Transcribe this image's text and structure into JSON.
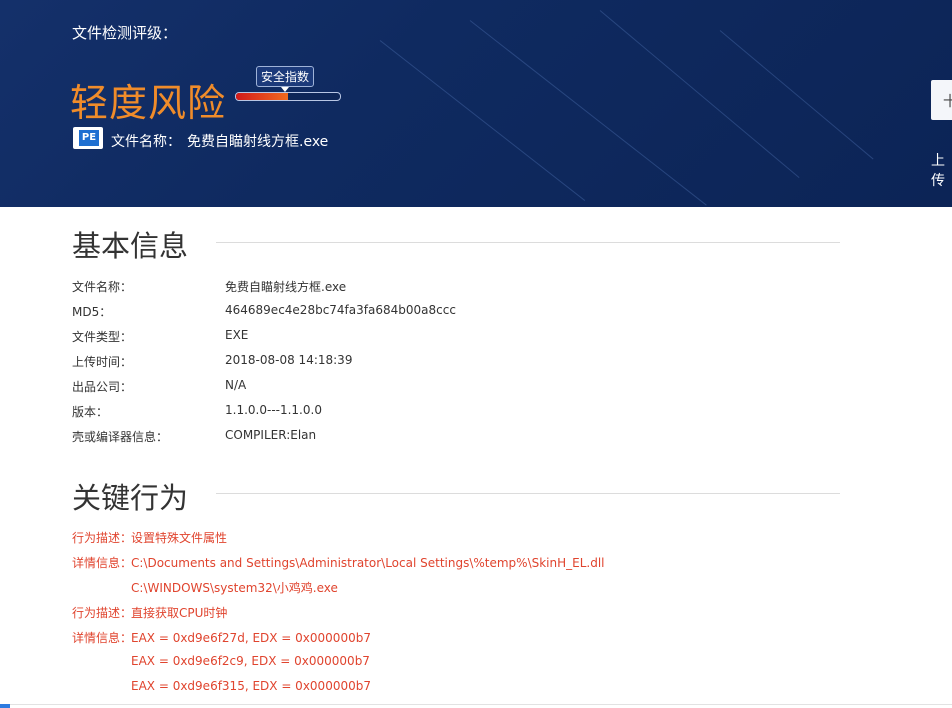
{
  "header": {
    "rating_label": "文件检测评级：",
    "risk_level": "轻度风险",
    "index_tag": "安全指数",
    "safety_index_fraction": 0.5,
    "file_name_label": "文件名称：",
    "file_name": "免费自瞄射线方框.exe",
    "file_icon_text": "PE",
    "right_button_glyph": "十",
    "right_text": "上传"
  },
  "basic_info": {
    "title": "基本信息",
    "rows": [
      {
        "key": "文件名称：",
        "value": "免费自瞄射线方框.exe"
      },
      {
        "key": "MD5：",
        "value": "464689ec4e28bc74fa3fa684b00a8ccc"
      },
      {
        "key": "文件类型：",
        "value": "EXE"
      },
      {
        "key": "上传时间：",
        "value": "2018-08-08 14:18:39"
      },
      {
        "key": "出品公司：",
        "value": "N/A"
      },
      {
        "key": "版本：",
        "value": "1.1.0.0---1.1.0.0"
      },
      {
        "key": "壳或编译器信息：",
        "value": "COMPILER:Elan"
      }
    ]
  },
  "key_behaviors": {
    "title": "关键行为",
    "lines": [
      {
        "key": "行为描述：",
        "value": "设置特殊文件属性"
      },
      {
        "key": "详情信息：",
        "value": "C:\\Documents and Settings\\Administrator\\Local Settings\\%temp%\\SkinH_EL.dll"
      },
      {
        "key": "",
        "value": "C:\\WINDOWS\\system32\\小鸡鸡.exe"
      },
      {
        "key": "行为描述：",
        "value": "直接获取CPU时钟"
      },
      {
        "key": "详情信息：",
        "value": "EAX = 0xd9e6f27d, EDX = 0x000000b7"
      },
      {
        "key": "",
        "value": "EAX = 0xd9e6f2c9, EDX = 0x000000b7"
      },
      {
        "key": "",
        "value": "EAX = 0xd9e6f315, EDX = 0x000000b7"
      }
    ]
  },
  "colors": {
    "header_bg": "#122c64",
    "risk_orange": "#f08c2a",
    "behavior_red": "#e0442e"
  }
}
